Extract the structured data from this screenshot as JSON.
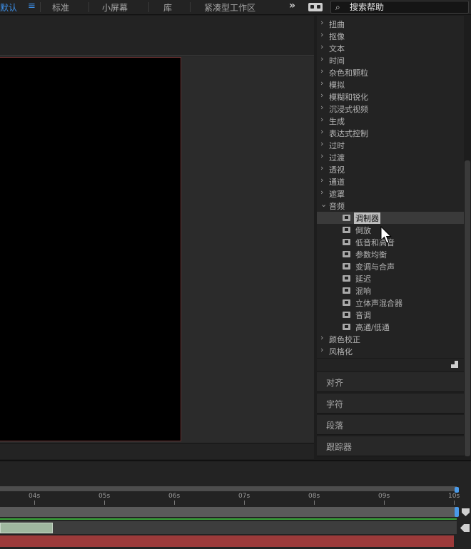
{
  "workspaces": {
    "default_label": "默认",
    "menu_glyph": "≡",
    "standard_label": "标准",
    "small_screen_label": "小屏幕",
    "library_label": "库",
    "compact_label": "紧凑型工作区",
    "more_glyph": "»"
  },
  "search": {
    "placeholder": "搜索帮助",
    "icon": "search-icon"
  },
  "effects": {
    "categories_top": [
      "扭曲",
      "抠像",
      "文本",
      "时间",
      "杂色和颗粒",
      "模拟",
      "模糊和锐化",
      "沉浸式视频",
      "生成",
      "表达式控制",
      "过时",
      "过渡",
      "透视",
      "通道",
      "遮罩"
    ],
    "expanded_category": "音频",
    "audio_items": [
      "调制器",
      "倒放",
      "低音和高音",
      "参数均衡",
      "变调与合声",
      "延迟",
      "混响",
      "立体声混合器",
      "音调",
      "高通/低通"
    ],
    "selected_item": "调制器",
    "categories_bottom": [
      "颜色校正",
      "风格化"
    ]
  },
  "side_panels": [
    "对齐",
    "字符",
    "段落",
    "跟踪器"
  ],
  "timeline": {
    "ticks": [
      "04s",
      "05s",
      "06s",
      "07s",
      "08s",
      "09s",
      "10s"
    ]
  },
  "colors": {
    "accent": "#3c8ee6",
    "track_green": "#9fb79f",
    "track_red": "#9c3a3a",
    "playhead": "#4a9ae8"
  }
}
